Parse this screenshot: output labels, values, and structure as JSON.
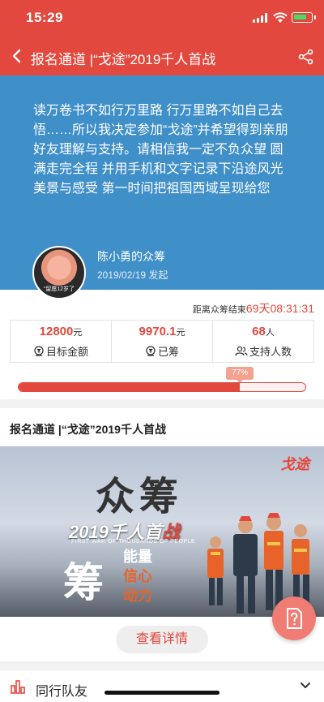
{
  "status_bar": {
    "time": "15:29"
  },
  "nav": {
    "title": "报名通道 |“戈途”2019千人首战"
  },
  "hero": {
    "slogan": "读万卷书不如行万里路 行万里路不如自己去悟……所以我决定参加“戈途”并希望得到亲朋好友理解与支持。请相信我一定不负众望 圆满走完全程 并用手机和文字记录下沿途风光美景与感受 第一时间把祖国西域呈现给您",
    "avatar_caption": "“留愿12岁了",
    "creator": "陈小勇的众筹",
    "date": "2019/02/19 发起"
  },
  "stats": {
    "deadline_label": "距离众筹结束",
    "deadline_value": "69天08:31:31",
    "items": [
      {
        "value": "12800",
        "unit": "元",
        "label": "目标金额"
      },
      {
        "value": "9970.1",
        "unit": "元",
        "label": "已筹"
      },
      {
        "value": "68",
        "unit": "人",
        "label": "支持人数"
      }
    ],
    "progress_text": "77%",
    "progress_fraction": 0.77
  },
  "section": {
    "title": "报名通道 |“戈途”2019千人首战",
    "banner": {
      "headline": "众筹",
      "subtitle": "2019千人首战",
      "subtitle_plain": "2019千人首",
      "subtitle_red": "战",
      "caption": "FIRST WAR OF THOUSANDS OF PEOPLE",
      "big_char": "筹",
      "side_lines": [
        "能量",
        "信心",
        "动力"
      ],
      "logo_text": "戈途"
    },
    "detail_button": "查看详情"
  },
  "bottom": {
    "label": "同行队友"
  }
}
